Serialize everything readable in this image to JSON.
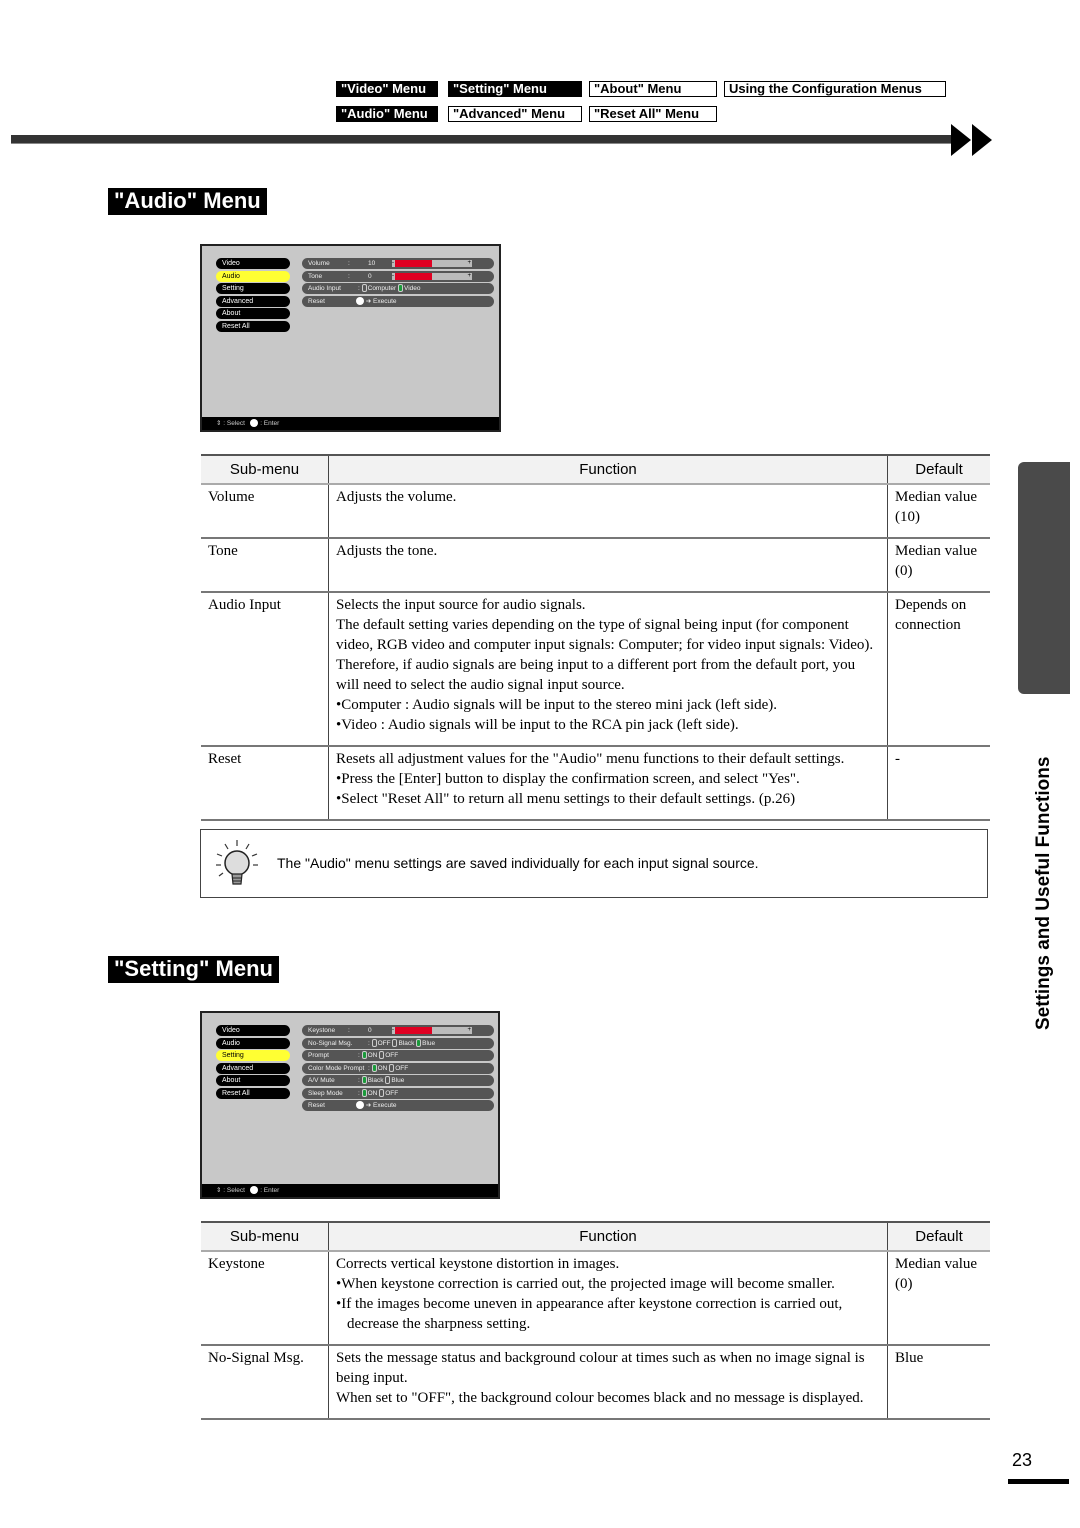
{
  "nav": {
    "row1": [
      {
        "label": "\"Video\" Menu",
        "style": "dark"
      },
      {
        "label": "\"Setting\" Menu",
        "style": "dark"
      },
      {
        "label": "\"About\" Menu",
        "style": "light"
      },
      {
        "label": "Using the Configuration Menus",
        "style": "light"
      }
    ],
    "row2": [
      {
        "label": "\"Audio\" Menu",
        "style": "dark"
      },
      {
        "label": "\"Advanced\" Menu",
        "style": "light"
      },
      {
        "label": "\"Reset All\" Menu",
        "style": "light"
      }
    ]
  },
  "sections": {
    "audio": {
      "title": "\"Audio\" Menu",
      "osd": {
        "left_menu": [
          "Video",
          "Audio",
          "Setting",
          "Advanced",
          "About",
          "Reset All"
        ],
        "selected": "Audio",
        "items": [
          {
            "label": "Volume",
            "colon": ":",
            "value": "10",
            "bar_fraction": 0.5
          },
          {
            "label": "Tone",
            "colon": ":",
            "value": "0",
            "bar_fraction": 0.5
          },
          {
            "label": "Audio Input",
            "colon": ":",
            "options": [
              "Computer",
              "Video"
            ],
            "selected_option": "Video"
          },
          {
            "label": "Reset",
            "action": "Execute"
          }
        ],
        "footer": {
          "select": ": Select",
          "enter": ": Enter"
        }
      },
      "table": {
        "headers": [
          "Sub-menu",
          "Function",
          "Default"
        ],
        "rows": [
          {
            "submenu": "Volume",
            "function": [
              "Adjusts the volume."
            ],
            "default": "Median value (10)"
          },
          {
            "submenu": "Tone",
            "function": [
              "Adjusts the tone."
            ],
            "default": "Median value (0)"
          },
          {
            "submenu": "Audio Input",
            "function": [
              "Selects the input source for audio signals.",
              "The default setting varies depending on the type of signal being input (for component video,  RGB video and computer input signals: Computer; for video input signals: Video). Therefore, if audio signals are being input to a different port from the default port, you will need to select the audio signal input source.",
              "•Computer : Audio signals will be input to the stereo mini jack (left side).",
              "•Video        : Audio signals will be input to the RCA pin jack (left side)."
            ],
            "default": "Depends on connection"
          },
          {
            "submenu": "Reset",
            "function": [
              "Resets all adjustment values for the \"Audio\" menu functions to their default settings.",
              "•Press the [Enter] button to display the confirmation screen, and select \"Yes\".",
              "•Select \"Reset All\" to return all menu settings to their default settings. (p.26)"
            ],
            "default": "-"
          }
        ]
      },
      "note": "The \"Audio\" menu settings are saved individually for each input signal source."
    },
    "setting": {
      "title": "\"Setting\" Menu",
      "osd": {
        "left_menu": [
          "Video",
          "Audio",
          "Setting",
          "Advanced",
          "About",
          "Reset All"
        ],
        "selected": "Setting",
        "items": [
          {
            "label": "Keystone",
            "colon": ":",
            "value": "0",
            "bar_fraction": 0.5
          },
          {
            "label": "No-Signal Msg.",
            "colon": ":",
            "options": [
              "OFF",
              "Black",
              "Blue"
            ],
            "selected_option": "Blue"
          },
          {
            "label": "Prompt",
            "colon": ":",
            "options": [
              "ON",
              "OFF"
            ],
            "selected_option": "ON"
          },
          {
            "label": "Color Mode Prompt",
            "colon": ":",
            "options": [
              "ON",
              "OFF"
            ],
            "selected_option": "ON"
          },
          {
            "label": "A/V Mute",
            "colon": ":",
            "options": [
              "Black",
              "Blue"
            ],
            "selected_option": "Black"
          },
          {
            "label": "Sleep Mode",
            "colon": ":",
            "options": [
              "ON",
              "OFF"
            ],
            "selected_option": "ON"
          },
          {
            "label": "Reset",
            "action": "Execute"
          }
        ],
        "footer": {
          "select": ": Select",
          "enter": ": Enter"
        }
      },
      "table": {
        "headers": [
          "Sub-menu",
          "Function",
          "Default"
        ],
        "rows": [
          {
            "submenu": "Keystone",
            "function": [
              "Corrects vertical keystone distortion in images.",
              "•When keystone correction is carried out, the projected image will become smaller.",
              "•If the images become uneven in appearance after keystone correction is carried out, decrease the sharpness setting."
            ],
            "default": "Median value (0)"
          },
          {
            "submenu": "No-Signal Msg.",
            "function": [
              "Sets the message status and background colour at times such as when no image signal is being input.",
              "When set to \"OFF\", the background colour becomes black and no message is displayed."
            ],
            "default": "Blue"
          }
        ]
      }
    }
  },
  "side_label": "Settings and Useful Functions",
  "page_number": "23",
  "colors": {
    "osd_selected": "#ffff33",
    "osd_bar": "#e00022",
    "osd_radio_on": "#1a9a3a",
    "side_tab": "#4a4a4a"
  }
}
